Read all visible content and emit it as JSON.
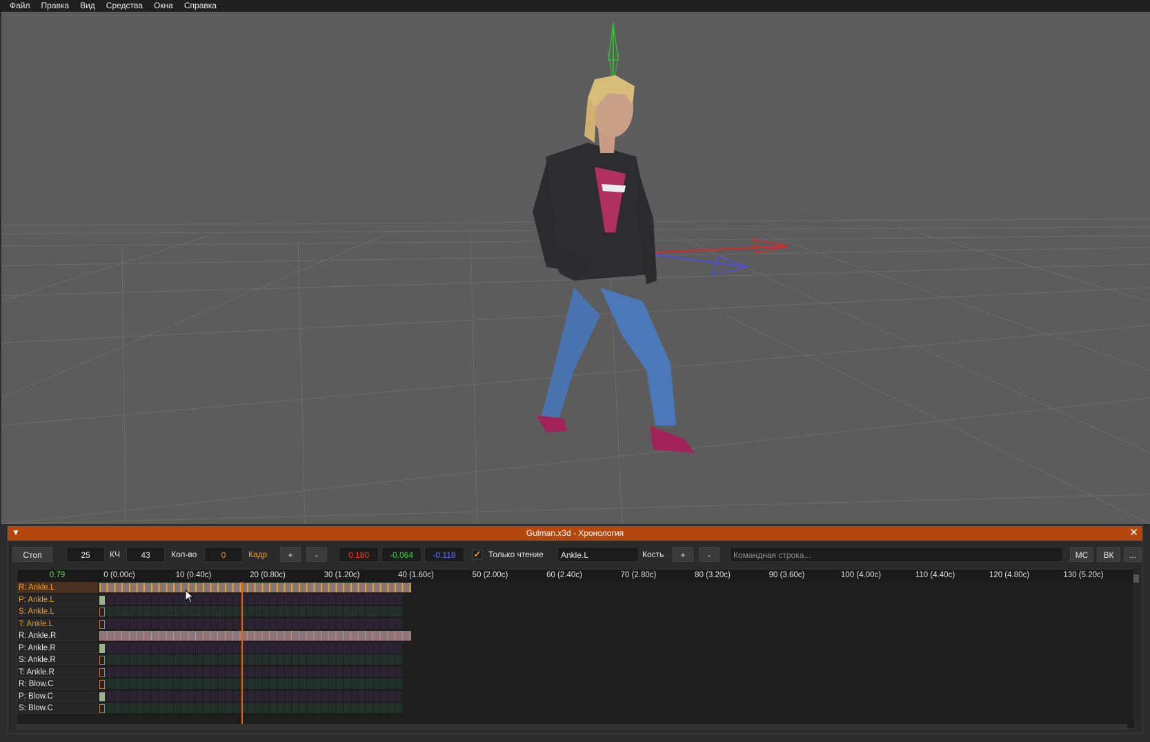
{
  "menu": [
    "Файл",
    "Правка",
    "Вид",
    "Средства",
    "Окна",
    "Справка"
  ],
  "timeline": {
    "title": "Gulman.x3d - Хронология",
    "collapse_icon": "▼",
    "close_icon": "✕",
    "toolbar": {
      "stop_label": "Стоп",
      "fps_value": "25",
      "fps_label": "КЧ",
      "count_value": "43",
      "count_label": "Кол-во",
      "frame_value": "0",
      "frame_label": "Кадр",
      "plus_label": "+",
      "minus_label": "-",
      "x_value": "0.180",
      "y_value": "-0.064",
      "z_value": "-0.118",
      "readonly_label": "Только чтение",
      "readonly_checked": true,
      "bone_name": "Ankle.L",
      "bone_label": "Кость",
      "bone_plus": "+",
      "bone_minus": "-",
      "command_placeholder": "Командная строка...",
      "mc_label": "MC",
      "vk_label": "ВК",
      "more_label": "..."
    },
    "ruler": {
      "current_time": "0.79",
      "ticks": [
        "0 (0.00c)",
        "10 (0.40c)",
        "20 (0.80c)",
        "30 (1.20c)",
        "40 (1.60c)",
        "50 (2.00c)",
        "60 (2.40c)",
        "70 (2.80c)",
        "80 (3.20c)",
        "90 (3.60c)",
        "100 (4.00c)",
        "110 (4.40c)",
        "120 (4.80c)",
        "130 (5.20c)"
      ]
    },
    "tracks": [
      {
        "label": "R: Ankle.L",
        "color": "#f0a020",
        "selected": true,
        "keys": "full-gold"
      },
      {
        "label": "P: Ankle.L",
        "color": "#f0a020",
        "selected": false,
        "keys": "first-green"
      },
      {
        "label": "S: Ankle.L",
        "color": "#f0a020",
        "selected": false,
        "keys": "first"
      },
      {
        "label": "T: Ankle.L",
        "color": "#f0a020",
        "selected": false,
        "keys": "first"
      },
      {
        "label": "R: Ankle.R",
        "color": "#e8e8e8",
        "selected": false,
        "keys": "full"
      },
      {
        "label": "P: Ankle.R",
        "color": "#e8e8e8",
        "selected": false,
        "keys": "first-green"
      },
      {
        "label": "S: Ankle.R",
        "color": "#e8e8e8",
        "selected": false,
        "keys": "first"
      },
      {
        "label": "T: Ankle.R",
        "color": "#e8e8e8",
        "selected": false,
        "keys": "first"
      },
      {
        "label": "R: Blow.C",
        "color": "#e8e8e8",
        "selected": false,
        "keys": "first"
      },
      {
        "label": "P: Blow.C",
        "color": "#e8e8e8",
        "selected": false,
        "keys": "first-green"
      },
      {
        "label": "S: Blow.C",
        "color": "#e8e8e8",
        "selected": false,
        "keys": "first"
      }
    ]
  },
  "colors": {
    "accent": "#b3470e",
    "x_color": "#ff3030",
    "y_color": "#40d040",
    "z_color": "#6a6aff",
    "gold": "#f0a020"
  }
}
